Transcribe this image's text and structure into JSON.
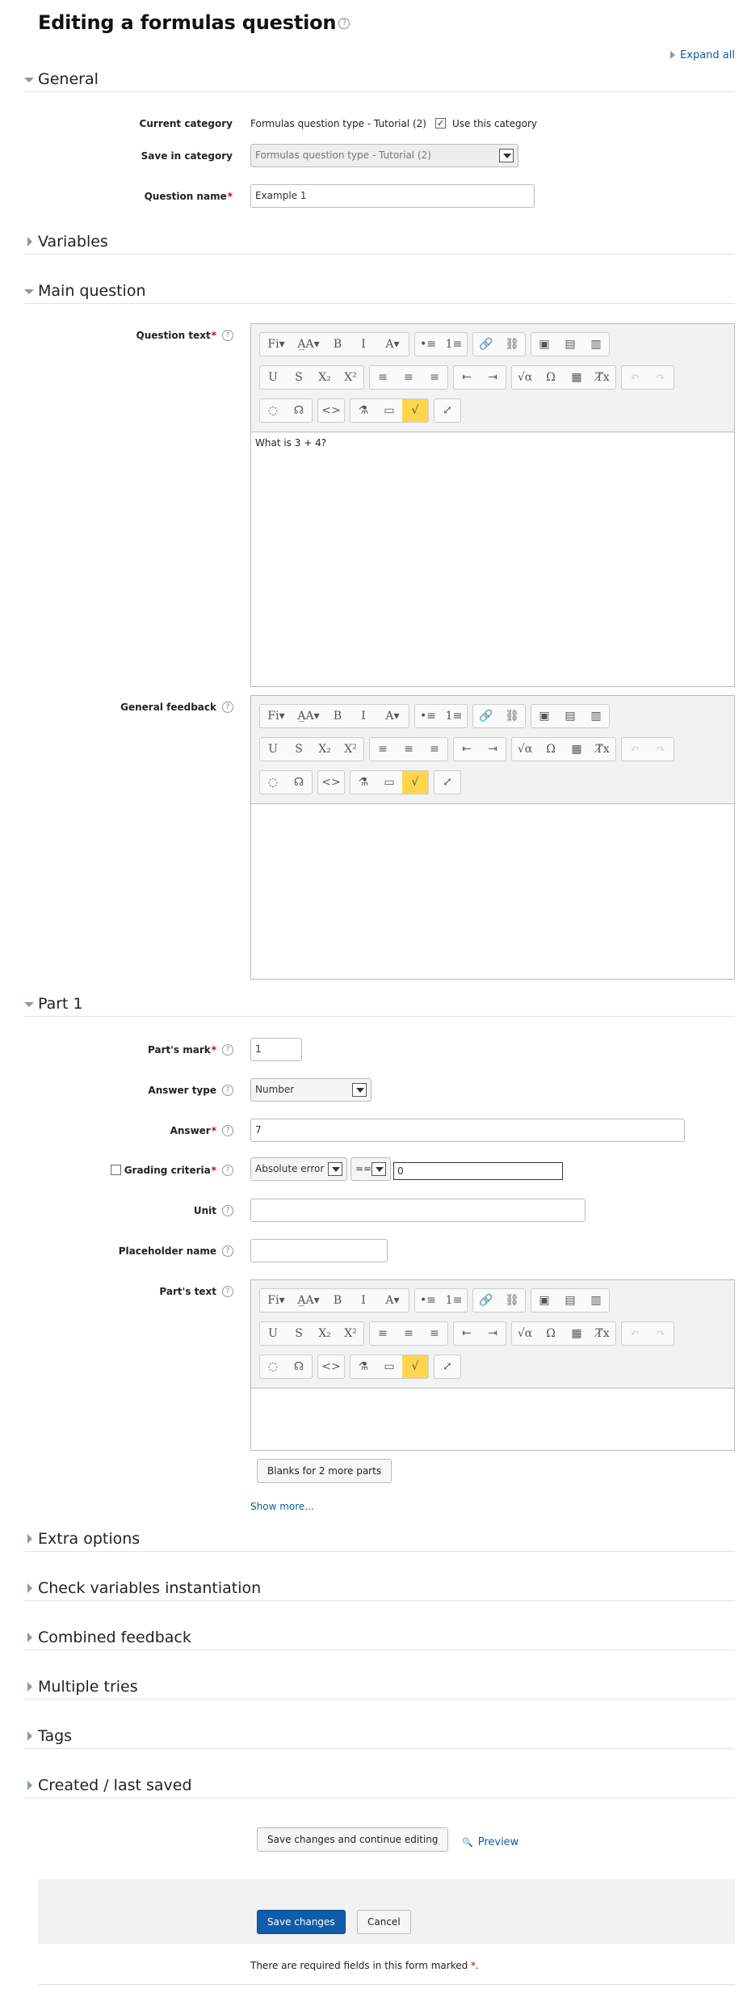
{
  "page": {
    "title": "Editing a formulas question",
    "expand_all": "Expand all",
    "required_note": "There are required fields in this form marked",
    "required_mark": "*"
  },
  "sections": {
    "general": "General",
    "variables": "Variables",
    "main_question": "Main question",
    "part1": "Part 1",
    "extra_options": "Extra options",
    "check_vars": "Check variables instantiation",
    "combined_feedback": "Combined feedback",
    "multiple_tries": "Multiple tries",
    "tags": "Tags",
    "created": "Created / last saved"
  },
  "general": {
    "current_category_label": "Current category",
    "current_category_value": "Formulas question type - Tutorial (2)",
    "use_category_label": "Use this category",
    "use_category_checked": true,
    "save_category_label": "Save in category",
    "save_category_value": "Formulas question type - Tutorial (2)",
    "question_name_label": "Question name",
    "question_name_value": "Example 1"
  },
  "main": {
    "question_text_label": "Question text",
    "question_text_value": "What is 3 + 4?",
    "general_feedback_label": "General feedback",
    "general_feedback_value": ""
  },
  "toolbar": {
    "row1": [
      [
        "Fi",
        "▾"
      ],
      [
        "A̲A",
        "▾"
      ],
      [
        "B"
      ],
      [
        "I"
      ],
      [
        "A",
        "▾"
      ],
      [
        "•≡"
      ],
      [
        "1≡"
      ],
      [
        "🔗"
      ],
      [
        "⛓"
      ],
      [
        "▣"
      ],
      [
        "▤"
      ],
      [
        "▥"
      ]
    ],
    "row2": [
      [
        "U"
      ],
      [
        "S"
      ],
      [
        "X₂"
      ],
      [
        "X²"
      ],
      [
        "≡"
      ],
      [
        "≡"
      ],
      [
        "≡"
      ],
      [
        "⇤"
      ],
      [
        "⇥"
      ],
      [
        "√α"
      ],
      [
        "Ω"
      ],
      [
        "▦"
      ],
      [
        "T̸x"
      ],
      [
        "↶"
      ],
      [
        "↷"
      ]
    ],
    "row3": [
      [
        "◌"
      ],
      [
        "☊"
      ],
      [
        "<>"
      ],
      [
        "⚗"
      ],
      [
        "▭"
      ],
      [
        "√"
      ],
      [
        "⤢"
      ]
    ]
  },
  "part1": {
    "mark_label": "Part's mark",
    "mark_value": "1",
    "answer_type_label": "Answer type",
    "answer_type_value": "Number",
    "answer_label": "Answer",
    "answer_value": "7",
    "grading_label": "Grading criteria",
    "grading_type": "Absolute error",
    "grading_op": "==",
    "grading_value": "0",
    "unit_label": "Unit",
    "unit_value": "",
    "placeholder_label": "Placeholder name",
    "placeholder_value": "",
    "parts_text_label": "Part's text",
    "parts_text_value": "",
    "blanks_button": "Blanks for 2 more parts",
    "show_more": "Show more..."
  },
  "actions": {
    "save_continue": "Save changes and continue editing",
    "preview": "Preview",
    "save": "Save changes",
    "cancel": "Cancel"
  },
  "icons": {
    "help": "question-circle-icon",
    "expand": "caret-right-icon",
    "collapse": "caret-down-icon",
    "preview": "magnifier-icon"
  }
}
